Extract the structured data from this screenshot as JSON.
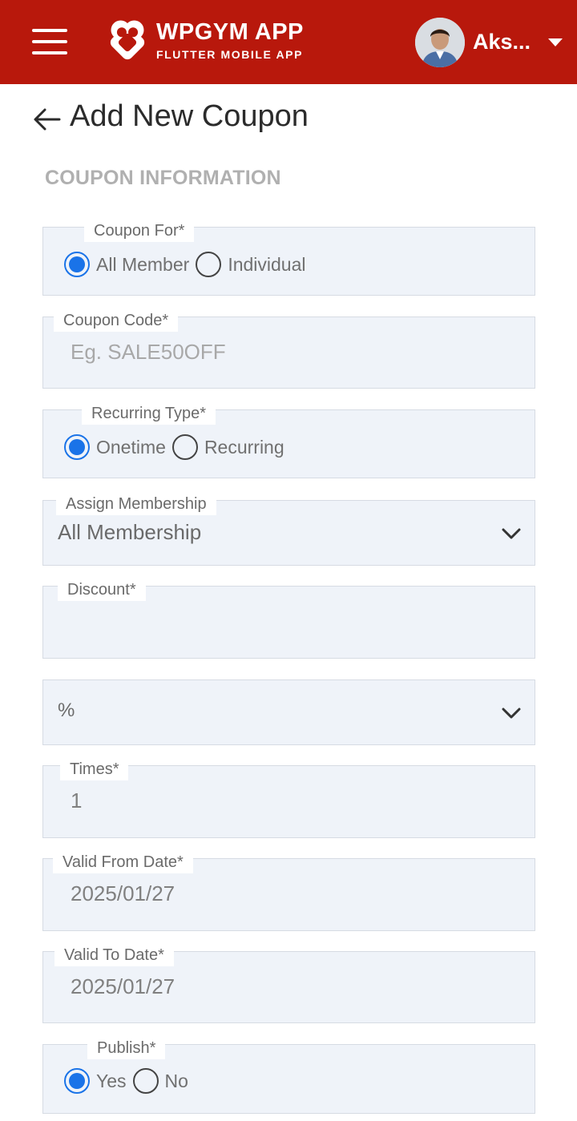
{
  "header": {
    "brand_title": "WPGYM APP",
    "brand_subtitle": "FLUTTER MOBILE APP",
    "user_name": "Aks...",
    "bar_color": "#b8180c"
  },
  "page": {
    "title": "Add New Coupon",
    "section_title": "COUPON INFORMATION"
  },
  "form": {
    "coupon_for": {
      "label": "Coupon For*",
      "options": [
        "All Member",
        "Individual"
      ],
      "selected": "All Member"
    },
    "coupon_code": {
      "label": "Coupon Code*",
      "value": "",
      "placeholder": "Eg. SALE50OFF"
    },
    "recurring_type": {
      "label": "Recurring Type*",
      "options": [
        "Onetime",
        "Recurring"
      ],
      "selected": "Onetime"
    },
    "assign_membership": {
      "label": "Assign Membership",
      "value": "All Membership"
    },
    "discount": {
      "label": "Discount*",
      "value": ""
    },
    "discount_type": {
      "value": "%"
    },
    "times": {
      "label": "Times*",
      "value": "1"
    },
    "valid_from": {
      "label": "Valid From Date*",
      "value": "2025/01/27"
    },
    "valid_to": {
      "label": "Valid To Date*",
      "value": "2025/01/27"
    },
    "publish": {
      "label": "Publish*",
      "options": [
        "Yes",
        "No"
      ],
      "selected": "Yes"
    }
  },
  "colors": {
    "accent": "#1a73e8",
    "field_bg": "#eff3f9",
    "section_title": "#b0b0b0"
  }
}
